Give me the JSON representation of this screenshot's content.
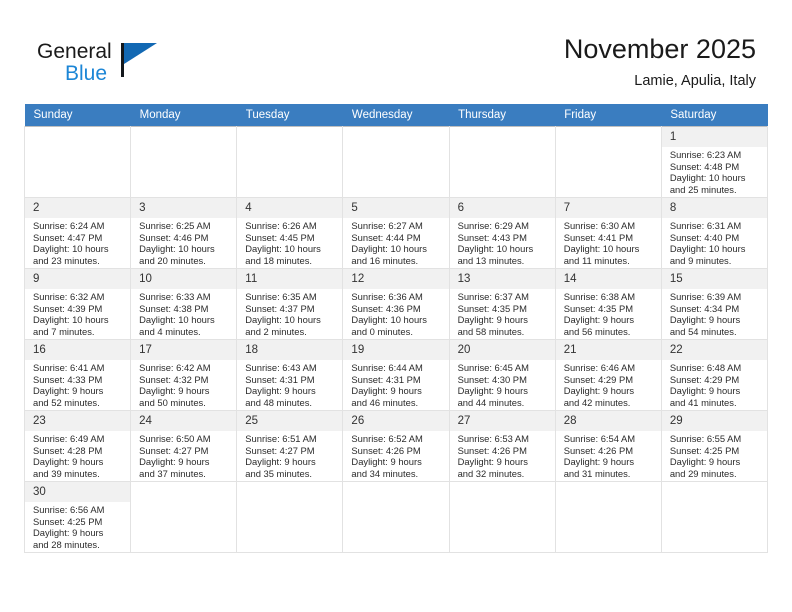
{
  "brand": {
    "name_part1": "General",
    "name_part2": "Blue",
    "flag_color": "#1268b3",
    "blue_color": "#1c86d6"
  },
  "header": {
    "title": "November 2025",
    "subtitle": "Lamie, Apulia, Italy",
    "header_bg": "#3a7dc0",
    "header_text_color": "#ffffff"
  },
  "weekdays": [
    "Sunday",
    "Monday",
    "Tuesday",
    "Wednesday",
    "Thursday",
    "Friday",
    "Saturday"
  ],
  "labels": {
    "sunrise_prefix": "Sunrise:",
    "sunset_prefix": "Sunset:",
    "daylight_prefix": "Daylight:"
  },
  "weeks": [
    [
      {
        "blank": true
      },
      {
        "blank": true
      },
      {
        "blank": true
      },
      {
        "blank": true
      },
      {
        "blank": true
      },
      {
        "blank": true
      },
      {
        "day": "1",
        "sunrise": "Sunrise: 6:23 AM",
        "sunset": "Sunset: 4:48 PM",
        "daylight_line1": "Daylight: 10 hours",
        "daylight_line2": "and 25 minutes."
      }
    ],
    [
      {
        "day": "2",
        "sunrise": "Sunrise: 6:24 AM",
        "sunset": "Sunset: 4:47 PM",
        "daylight_line1": "Daylight: 10 hours",
        "daylight_line2": "and 23 minutes."
      },
      {
        "day": "3",
        "sunrise": "Sunrise: 6:25 AM",
        "sunset": "Sunset: 4:46 PM",
        "daylight_line1": "Daylight: 10 hours",
        "daylight_line2": "and 20 minutes."
      },
      {
        "day": "4",
        "sunrise": "Sunrise: 6:26 AM",
        "sunset": "Sunset: 4:45 PM",
        "daylight_line1": "Daylight: 10 hours",
        "daylight_line2": "and 18 minutes."
      },
      {
        "day": "5",
        "sunrise": "Sunrise: 6:27 AM",
        "sunset": "Sunset: 4:44 PM",
        "daylight_line1": "Daylight: 10 hours",
        "daylight_line2": "and 16 minutes."
      },
      {
        "day": "6",
        "sunrise": "Sunrise: 6:29 AM",
        "sunset": "Sunset: 4:43 PM",
        "daylight_line1": "Daylight: 10 hours",
        "daylight_line2": "and 13 minutes."
      },
      {
        "day": "7",
        "sunrise": "Sunrise: 6:30 AM",
        "sunset": "Sunset: 4:41 PM",
        "daylight_line1": "Daylight: 10 hours",
        "daylight_line2": "and 11 minutes."
      },
      {
        "day": "8",
        "sunrise": "Sunrise: 6:31 AM",
        "sunset": "Sunset: 4:40 PM",
        "daylight_line1": "Daylight: 10 hours",
        "daylight_line2": "and 9 minutes."
      }
    ],
    [
      {
        "day": "9",
        "sunrise": "Sunrise: 6:32 AM",
        "sunset": "Sunset: 4:39 PM",
        "daylight_line1": "Daylight: 10 hours",
        "daylight_line2": "and 7 minutes."
      },
      {
        "day": "10",
        "sunrise": "Sunrise: 6:33 AM",
        "sunset": "Sunset: 4:38 PM",
        "daylight_line1": "Daylight: 10 hours",
        "daylight_line2": "and 4 minutes."
      },
      {
        "day": "11",
        "sunrise": "Sunrise: 6:35 AM",
        "sunset": "Sunset: 4:37 PM",
        "daylight_line1": "Daylight: 10 hours",
        "daylight_line2": "and 2 minutes."
      },
      {
        "day": "12",
        "sunrise": "Sunrise: 6:36 AM",
        "sunset": "Sunset: 4:36 PM",
        "daylight_line1": "Daylight: 10 hours",
        "daylight_line2": "and 0 minutes."
      },
      {
        "day": "13",
        "sunrise": "Sunrise: 6:37 AM",
        "sunset": "Sunset: 4:35 PM",
        "daylight_line1": "Daylight: 9 hours",
        "daylight_line2": "and 58 minutes."
      },
      {
        "day": "14",
        "sunrise": "Sunrise: 6:38 AM",
        "sunset": "Sunset: 4:35 PM",
        "daylight_line1": "Daylight: 9 hours",
        "daylight_line2": "and 56 minutes."
      },
      {
        "day": "15",
        "sunrise": "Sunrise: 6:39 AM",
        "sunset": "Sunset: 4:34 PM",
        "daylight_line1": "Daylight: 9 hours",
        "daylight_line2": "and 54 minutes."
      }
    ],
    [
      {
        "day": "16",
        "sunrise": "Sunrise: 6:41 AM",
        "sunset": "Sunset: 4:33 PM",
        "daylight_line1": "Daylight: 9 hours",
        "daylight_line2": "and 52 minutes."
      },
      {
        "day": "17",
        "sunrise": "Sunrise: 6:42 AM",
        "sunset": "Sunset: 4:32 PM",
        "daylight_line1": "Daylight: 9 hours",
        "daylight_line2": "and 50 minutes."
      },
      {
        "day": "18",
        "sunrise": "Sunrise: 6:43 AM",
        "sunset": "Sunset: 4:31 PM",
        "daylight_line1": "Daylight: 9 hours",
        "daylight_line2": "and 48 minutes."
      },
      {
        "day": "19",
        "sunrise": "Sunrise: 6:44 AM",
        "sunset": "Sunset: 4:31 PM",
        "daylight_line1": "Daylight: 9 hours",
        "daylight_line2": "and 46 minutes."
      },
      {
        "day": "20",
        "sunrise": "Sunrise: 6:45 AM",
        "sunset": "Sunset: 4:30 PM",
        "daylight_line1": "Daylight: 9 hours",
        "daylight_line2": "and 44 minutes."
      },
      {
        "day": "21",
        "sunrise": "Sunrise: 6:46 AM",
        "sunset": "Sunset: 4:29 PM",
        "daylight_line1": "Daylight: 9 hours",
        "daylight_line2": "and 42 minutes."
      },
      {
        "day": "22",
        "sunrise": "Sunrise: 6:48 AM",
        "sunset": "Sunset: 4:29 PM",
        "daylight_line1": "Daylight: 9 hours",
        "daylight_line2": "and 41 minutes."
      }
    ],
    [
      {
        "day": "23",
        "sunrise": "Sunrise: 6:49 AM",
        "sunset": "Sunset: 4:28 PM",
        "daylight_line1": "Daylight: 9 hours",
        "daylight_line2": "and 39 minutes."
      },
      {
        "day": "24",
        "sunrise": "Sunrise: 6:50 AM",
        "sunset": "Sunset: 4:27 PM",
        "daylight_line1": "Daylight: 9 hours",
        "daylight_line2": "and 37 minutes."
      },
      {
        "day": "25",
        "sunrise": "Sunrise: 6:51 AM",
        "sunset": "Sunset: 4:27 PM",
        "daylight_line1": "Daylight: 9 hours",
        "daylight_line2": "and 35 minutes."
      },
      {
        "day": "26",
        "sunrise": "Sunrise: 6:52 AM",
        "sunset": "Sunset: 4:26 PM",
        "daylight_line1": "Daylight: 9 hours",
        "daylight_line2": "and 34 minutes."
      },
      {
        "day": "27",
        "sunrise": "Sunrise: 6:53 AM",
        "sunset": "Sunset: 4:26 PM",
        "daylight_line1": "Daylight: 9 hours",
        "daylight_line2": "and 32 minutes."
      },
      {
        "day": "28",
        "sunrise": "Sunrise: 6:54 AM",
        "sunset": "Sunset: 4:26 PM",
        "daylight_line1": "Daylight: 9 hours",
        "daylight_line2": "and 31 minutes."
      },
      {
        "day": "29",
        "sunrise": "Sunrise: 6:55 AM",
        "sunset": "Sunset: 4:25 PM",
        "daylight_line1": "Daylight: 9 hours",
        "daylight_line2": "and 29 minutes."
      }
    ],
    [
      {
        "day": "30",
        "sunrise": "Sunrise: 6:56 AM",
        "sunset": "Sunset: 4:25 PM",
        "daylight_line1": "Daylight: 9 hours",
        "daylight_line2": "and 28 minutes."
      },
      {
        "blank": true
      },
      {
        "blank": true
      },
      {
        "blank": true
      },
      {
        "blank": true
      },
      {
        "blank": true
      },
      {
        "blank": true
      }
    ]
  ]
}
